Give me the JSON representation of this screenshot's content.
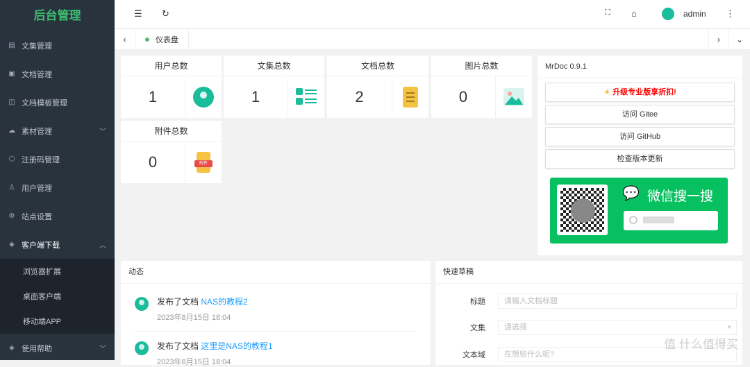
{
  "sidebar": {
    "logo": "后台管理",
    "items": [
      {
        "label": "文集管理",
        "icon": "file-icon"
      },
      {
        "label": "文档管理",
        "icon": "clipboard-icon"
      },
      {
        "label": "文档模板管理",
        "icon": "template-icon"
      },
      {
        "label": "素材管理",
        "icon": "cloud-upload-icon"
      },
      {
        "label": "注册码管理",
        "icon": "cube-icon"
      },
      {
        "label": "用户管理",
        "icon": "user-icon"
      },
      {
        "label": "站点设置",
        "icon": "gear-icon"
      },
      {
        "label": "客户端下载",
        "icon": "layers-icon"
      }
    ],
    "sub_items": [
      "浏览器扩展",
      "桌面客户端",
      "移动端APP"
    ],
    "help": "使用帮助"
  },
  "header": {
    "user": "admin"
  },
  "tabs": {
    "active": "仪表盘"
  },
  "stats": [
    {
      "title": "用户总数",
      "value": "1"
    },
    {
      "title": "文集总数",
      "value": "1"
    },
    {
      "title": "文档总数",
      "value": "2"
    },
    {
      "title": "图片总数",
      "value": "0"
    },
    {
      "title": "附件总数",
      "value": "0",
      "badge": "附件"
    }
  ],
  "info": {
    "title": "MrDoc 0.9.1",
    "upgrade": "升级专业版享折扣!",
    "gitee": "访问 Gitee",
    "github": "访问 GitHub",
    "check": "检查版本更新",
    "wechat": "微信搜一搜"
  },
  "activity": {
    "title": "动态",
    "items": [
      {
        "action": "发布了文档",
        "link": "NAS的教程2",
        "time": "2023年8月15日 18:04"
      },
      {
        "action": "发布了文档",
        "link": "这里是NAS的教程1",
        "time": "2023年8月15日 18:04"
      }
    ]
  },
  "draft": {
    "title": "快速草稿",
    "title_label": "标题",
    "title_placeholder": "请输入文档标题",
    "collection_label": "文集",
    "collection_placeholder": "请选择",
    "body_label": "文本域",
    "body_placeholder": "在想些什么呢?"
  },
  "watermark": "值 什么值得买"
}
